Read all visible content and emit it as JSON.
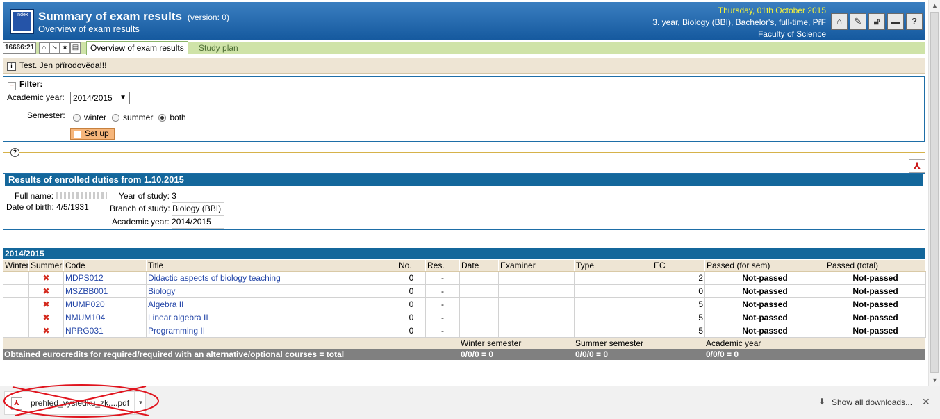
{
  "header": {
    "logo_text": "index",
    "title": "Summary of exam results",
    "version": "(version: 0)",
    "subtitle": "Overview of exam results",
    "date": "Thursday, 01th October 2015",
    "student_info": "3. year, Biology (BBI), Bachelor's, full-time, PřF",
    "faculty": "Faculty of Science",
    "icons": [
      "home-icon",
      "key-icon",
      "lock-icon",
      "flag-icon",
      "help-icon"
    ]
  },
  "tabbar": {
    "counter": "16666:21",
    "active_tab": "Overview of exam results",
    "inactive_tab": "Study plan"
  },
  "notice": {
    "text": "Test. Jen přírodověda!!!"
  },
  "filter": {
    "header": "Filter:",
    "academic_year_label": "Academic year:",
    "academic_year_value": "2014/2015",
    "semester_label": "Semester:",
    "semesters": [
      "winter",
      "summer",
      "both"
    ],
    "selected_semester": "both",
    "setup_label": "Set up"
  },
  "results": {
    "title": "Results of enrolled duties from 1.10.2015",
    "full_name_label": "Full name:",
    "dob_label": "Date of birth:",
    "dob_value": "4/5/1931",
    "year_label": "Year of study:",
    "year_value": "3",
    "branch_label": "Branch of study:",
    "branch_value": "Biology (BBI)",
    "academic_year_label": "Academic year:",
    "academic_year_value": "2014/2015"
  },
  "table": {
    "year": "2014/2015",
    "columns": [
      "Winter",
      "Summer",
      "Code",
      "Title",
      "No.",
      "Res.",
      "Date",
      "Examiner",
      "Type",
      "EC",
      "Passed (for sem)",
      "Passed (total)"
    ],
    "rows": [
      {
        "summer": "✖",
        "code": "MDPS012",
        "title": "Didactic aspects of biology teaching",
        "no": "0",
        "res": "-",
        "ec": "2",
        "passed_sem": "Not-passed",
        "passed_total": "Not-passed"
      },
      {
        "summer": "✖",
        "code": "MSZBB001",
        "title": "Biology",
        "no": "0",
        "res": "-",
        "ec": "0",
        "passed_sem": "Not-passed",
        "passed_total": "Not-passed"
      },
      {
        "summer": "✖",
        "code": "MUMP020",
        "title": "Algebra II",
        "no": "0",
        "res": "-",
        "ec": "5",
        "passed_sem": "Not-passed",
        "passed_total": "Not-passed"
      },
      {
        "summer": "✖",
        "code": "NMUM104",
        "title": "Linear algebra II",
        "no": "0",
        "res": "-",
        "ec": "5",
        "passed_sem": "Not-passed",
        "passed_total": "Not-passed"
      },
      {
        "summer": "✖",
        "code": "NPRG031",
        "title": "Programming II",
        "no": "0",
        "res": "-",
        "ec": "5",
        "passed_sem": "Not-passed",
        "passed_total": "Not-passed"
      }
    ],
    "summary": {
      "winter_label": "Winter semester",
      "summer_label": "Summer semester",
      "academic_label": "Academic year",
      "total_label": "Obtained eurocredits for required/required with an alternative/optional courses = total",
      "winter_value": "0/0/0 = 0",
      "summer_value": "0/0/0 = 0",
      "academic_value": "0/0/0 = 0"
    }
  },
  "download_bar": {
    "file_name": "prehled_vysledku_zk....pdf",
    "show_all": "Show all downloads..."
  }
}
